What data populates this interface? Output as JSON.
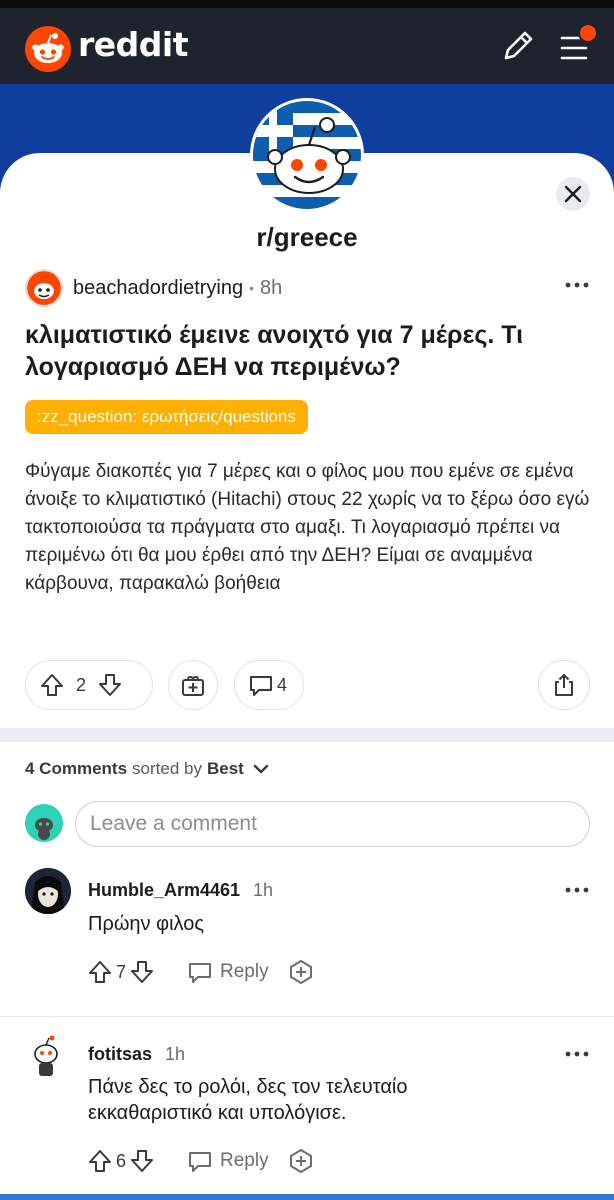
{
  "app": {
    "name": "reddit"
  },
  "colors": {
    "brand": "#ff4500",
    "topbar": "#1f232d",
    "banner": "#0f3f9e",
    "flair": "#ffb000"
  },
  "subreddit": {
    "name": "r/greece"
  },
  "post": {
    "author": "beachadordietrying",
    "separator": "•",
    "time": "8h",
    "title": "κλιματιστικό έμεινε ανοιχτό για 7 μέρες. Τι λογαριασμό ΔΕΗ να περιμένω?",
    "flair": ":zz_question: ερωτήσεις/questions",
    "body": "Φύγαμε διακοπές για 7 μέρες και ο φίλος μου που εμένε σε εμένα άνοιξε το κλιματιστικό (Hitachi) στους 22 χωρίς να το ξέρω όσο εγώ τακτοποιούσα τα πράγματα στο αμαξι. Τι λογαριασμό πρέπει να περιμένω ότι θα μου έρθει από την ΔΕΗ? Είμαι σε αναμμένα κάρβουνα, παρακαλώ βοήθεια",
    "votes": "2",
    "comments": "4"
  },
  "comments_header": {
    "count_label": "4 Comments",
    "sorted_by": "sorted by",
    "sort": "Best"
  },
  "comment_input": {
    "placeholder": "Leave a comment"
  },
  "comments": [
    {
      "author": "Humble_Arm4461",
      "time": "1h",
      "text": "Πρώην φιλος",
      "votes": "7",
      "reply": "Reply"
    },
    {
      "author": "fotitsas",
      "time": "1h",
      "text": "Πάνε δες το ρολόι, δες τον τελευταίο εκκαθαριστικό και υπολόγισε.",
      "votes": "6",
      "reply": "Reply"
    }
  ],
  "icons": {
    "logo": "reddit-logo-icon",
    "pencil": "pencil-icon",
    "menu": "hamburger-menu-icon",
    "close": "close-icon",
    "more": "more-horizontal-icon",
    "upvote": "upvote-arrow-icon",
    "downvote": "downvote-arrow-icon",
    "award": "award-icon",
    "comment": "comment-bubble-icon",
    "share": "share-icon",
    "chevron": "chevron-down-icon"
  }
}
